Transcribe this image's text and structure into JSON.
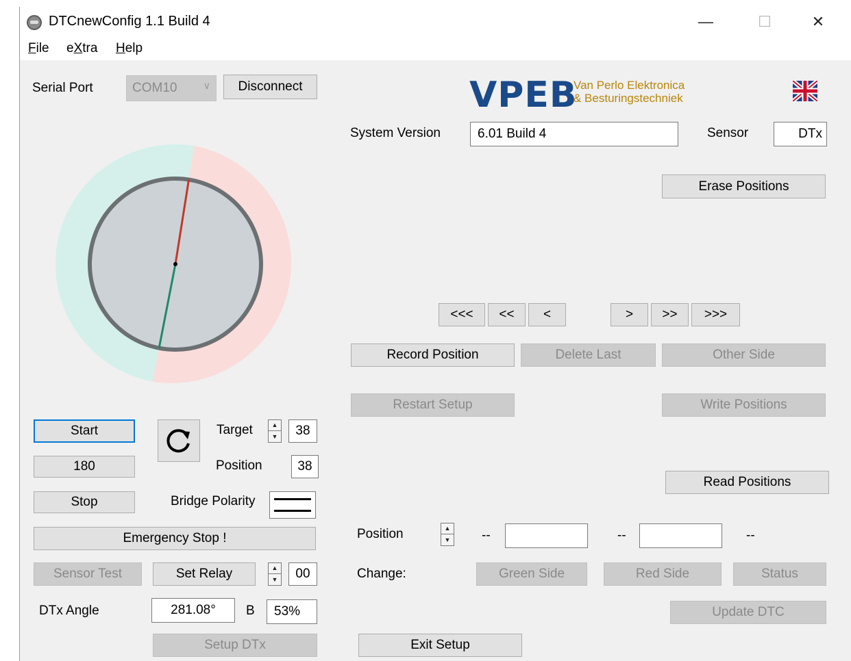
{
  "window": {
    "title": "DTCnewConfig 1.1 Build 4",
    "minimize_glyph": "—",
    "maximize_glyph": "☐",
    "close_glyph": "✕"
  },
  "menu": [
    {
      "accel": "F",
      "rest": "ile"
    },
    {
      "pre": "e",
      "accel": "X",
      "rest": "tra"
    },
    {
      "accel": "H",
      "rest": "elp"
    }
  ],
  "serial": {
    "label": "Serial Port",
    "port": "COM10",
    "disconnect_label": "Disconnect"
  },
  "brand": {
    "letters": "VPEB",
    "tagline1": "Van Perlo Elektronica",
    "tagline2": "& Besturingstechniek"
  },
  "system": {
    "version_label": "System Version",
    "version_value": "6.01 Build 4",
    "sensor_label": "Sensor",
    "sensor_value": "DTx"
  },
  "dial": {
    "pointer_red_deg": 9,
    "pointer_green_deg": 191,
    "zone_green_color": "#d5f0ea",
    "zone_red_color": "#fadcda"
  },
  "controls": {
    "start": "Start",
    "speed": "180",
    "stop": "Stop",
    "emergency": "Emergency Stop !",
    "target_label": "Target",
    "target_value": "38",
    "position_label": "Position",
    "position_value": "38",
    "bridge_polarity_label": "Bridge Polarity",
    "sensor_test": "Sensor Test",
    "set_relay": "Set Relay",
    "relay_value": "00",
    "dtx_angle_label": "DTx Angle",
    "dtx_angle_value": "281.08°",
    "b_label": "B",
    "b_value": "53%",
    "setup_dtx": "Setup DTx"
  },
  "positions": {
    "erase": "Erase Positions",
    "nav": [
      "<<<",
      "<<",
      "<",
      ">",
      ">>",
      ">>>"
    ],
    "record": "Record Position",
    "delete_last": "Delete Last",
    "other_side": "Other Side",
    "restart_setup": "Restart Setup",
    "write": "Write Positions",
    "read": "Read Positions",
    "position_label": "Position",
    "dash1": "--",
    "dash2": "--",
    "dash3": "--",
    "change_label": "Change:",
    "green_side": "Green Side",
    "red_side": "Red Side",
    "status": "Status",
    "update_dtc": "Update DTC",
    "exit_setup": "Exit Setup"
  }
}
